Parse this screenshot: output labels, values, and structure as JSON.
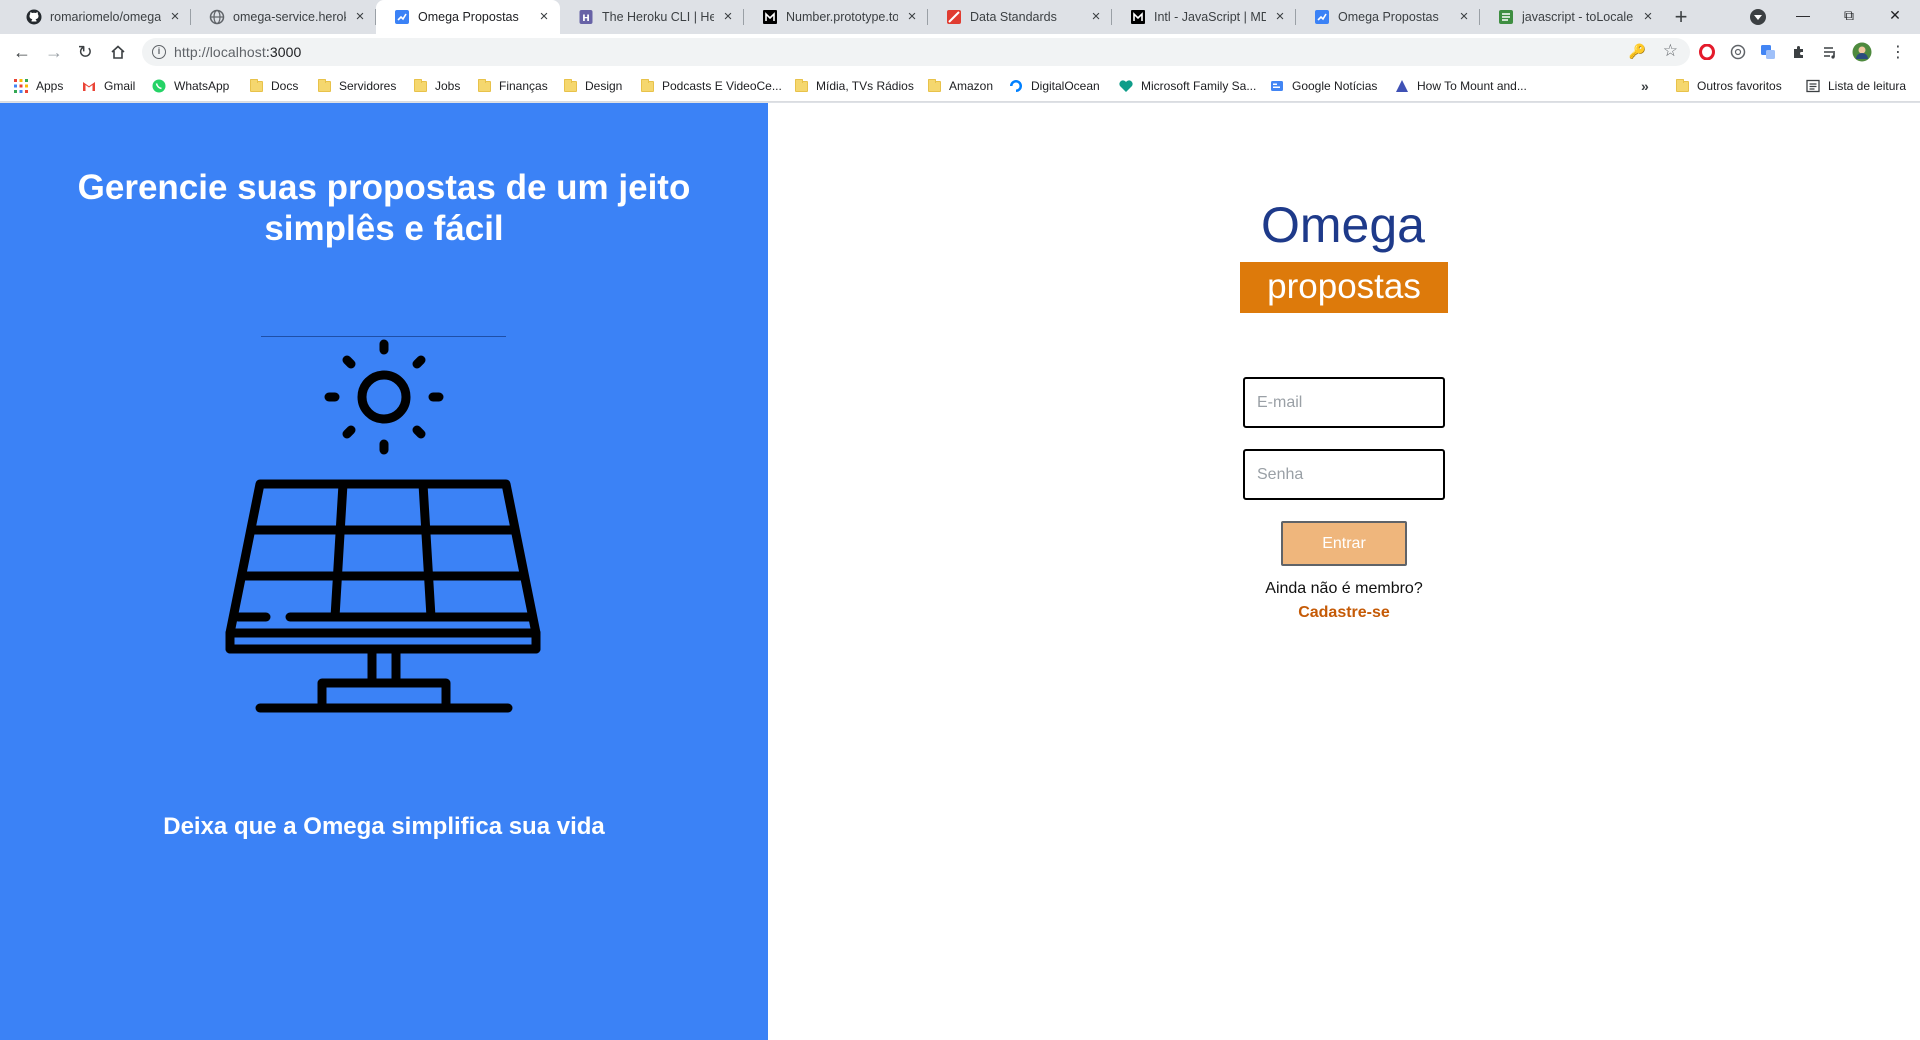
{
  "browser": {
    "tabs": [
      {
        "title": "romariomelo/omega-c",
        "icon": "github-icon",
        "active": false
      },
      {
        "title": "omega-service.herokuapp",
        "icon": "globe-icon",
        "active": false
      },
      {
        "title": "Omega Propostas",
        "icon": "omega-app-icon",
        "active": true
      },
      {
        "title": "The Heroku CLI | Heroku",
        "icon": "heroku-icon",
        "active": false
      },
      {
        "title": "Number.prototype.toL",
        "icon": "mdn-icon",
        "active": false
      },
      {
        "title": "Data Standards",
        "icon": "data-standards-icon",
        "active": false
      },
      {
        "title": "Intl - JavaScript | MDN",
        "icon": "mdn-icon",
        "active": false
      },
      {
        "title": "Omega Propostas",
        "icon": "omega-app-icon",
        "active": false
      },
      {
        "title": "javascript - toLocaleSt",
        "icon": "stackoverflow-icon",
        "active": false
      }
    ],
    "url_host": "http://localhost",
    "url_port": ":3000",
    "bookmarks": [
      {
        "label": "Apps",
        "icon": "apps-grid-icon"
      },
      {
        "label": "Gmail",
        "icon": "gmail-icon"
      },
      {
        "label": "WhatsApp",
        "icon": "whatsapp-icon"
      },
      {
        "label": "Docs",
        "icon": "folder-icon"
      },
      {
        "label": "Servidores",
        "icon": "folder-icon"
      },
      {
        "label": "Jobs",
        "icon": "folder-icon"
      },
      {
        "label": "Finanças",
        "icon": "folder-icon"
      },
      {
        "label": "Design",
        "icon": "folder-icon"
      },
      {
        "label": "Podcasts E VideoCe...",
        "icon": "folder-icon"
      },
      {
        "label": "Mídia, TVs Rádios",
        "icon": "folder-icon"
      },
      {
        "label": "Amazon",
        "icon": "folder-icon"
      },
      {
        "label": "DigitalOcean",
        "icon": "digitalocean-icon"
      },
      {
        "label": "Microsoft Family Sa...",
        "icon": "microsoft-family-icon"
      },
      {
        "label": "Google Notícias",
        "icon": "google-news-icon"
      },
      {
        "label": "How To Mount and...",
        "icon": "bookmark-page-icon"
      }
    ],
    "bookmarks_more": "»",
    "other_bookmarks": "Outros favoritos",
    "reading_list": "Lista de leitura"
  },
  "hero": {
    "title": "Gerencie suas propostas de um jeito simplês e fácil",
    "subtitle": "Deixa que a Omega simplifica sua vida",
    "illustration": "solar-panel-icon",
    "color": "#3b82f6"
  },
  "login": {
    "brand_name": "Omega",
    "brand_tag": "propostas",
    "email_placeholder": "E-mail",
    "password_placeholder": "Senha",
    "submit_label": "Entrar",
    "not_member_text": "Ainda não é membro?",
    "signup_label": "Cadastre-se",
    "colors": {
      "brand": "#1e3a8a",
      "accent": "#dd7a0b",
      "button": "#efb67c"
    }
  }
}
